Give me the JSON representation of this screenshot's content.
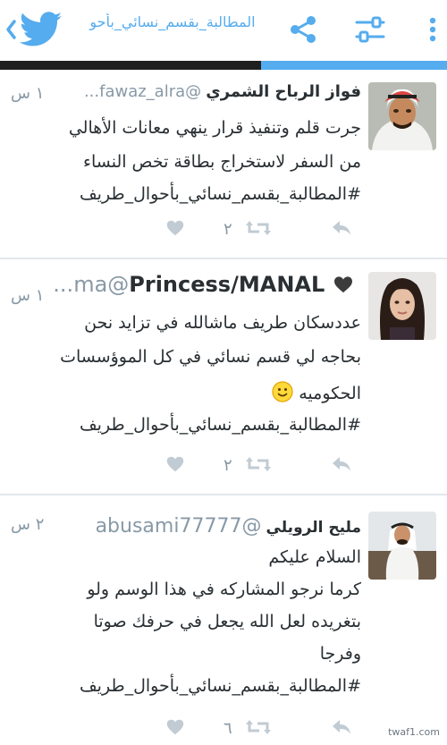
{
  "topbar": {
    "title": "المطالبة_بقسم_نسائي_بأحو"
  },
  "colors": {
    "accent": "#55acee",
    "muted": "#8899a6",
    "text": "#292f33"
  },
  "icons": [
    "chevron-left-icon",
    "twitter-bird-icon",
    "share-icon",
    "filter-icon",
    "more-vertical-icon",
    "reply-icon",
    "retweet-icon",
    "like-icon",
    "smiley-emoji-icon",
    "heart-emoji-icon"
  ],
  "tweets": [
    {
      "name": "فواز الرباح الشمري",
      "handle": "@fawaz_alra...",
      "time": "١ س",
      "lines": [
        "جرت قلم وتنفيذ قرار ينهي معانات الأهالي",
        "من السفر لاستخراج بطاقة تخص النساء",
        "#المطالبة_بقسم_نسائي_بأحوال_طريف"
      ],
      "retweets": "٢"
    },
    {
      "name": "Princess/MANAL",
      "handle": "@ma...",
      "time": "١ س",
      "lines": [
        "عددسكان طريف ماشالله في تزايد نحن",
        "بحاجه لي قسم نسائي في كل الموؤسسات",
        "الحكوميه",
        "#المطالبة_بقسم_نسائي_بأحوال_طريف"
      ],
      "retweets": "٢"
    },
    {
      "name": "مليح الرويلي",
      "handle": "@abusami77777",
      "time": "٢ س",
      "lines": [
        "السلام عليكم",
        "كرما نرجو المشاركه في هذا الوسم ولو",
        "بتغريده لعل الله يجعل في حرفك صوتا",
        "وفرجا",
        "#المطالبة_بقسم_نسائي_بأحوال_طريف"
      ],
      "retweets": "٦"
    }
  ],
  "watermark": "twaf1.com"
}
